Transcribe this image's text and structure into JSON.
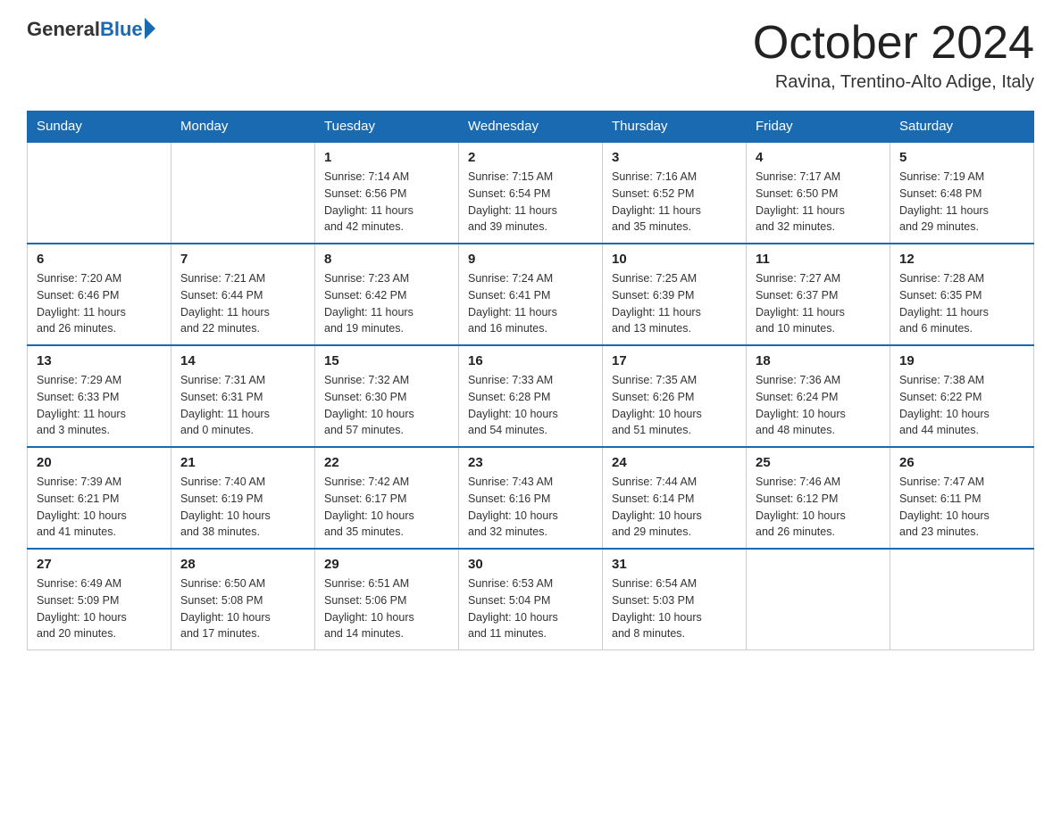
{
  "logo": {
    "general": "General",
    "blue": "Blue"
  },
  "title": "October 2024",
  "location": "Ravina, Trentino-Alto Adige, Italy",
  "headers": [
    "Sunday",
    "Monday",
    "Tuesday",
    "Wednesday",
    "Thursday",
    "Friday",
    "Saturday"
  ],
  "weeks": [
    [
      {
        "day": "",
        "details": ""
      },
      {
        "day": "",
        "details": ""
      },
      {
        "day": "1",
        "details": "Sunrise: 7:14 AM\nSunset: 6:56 PM\nDaylight: 11 hours\nand 42 minutes."
      },
      {
        "day": "2",
        "details": "Sunrise: 7:15 AM\nSunset: 6:54 PM\nDaylight: 11 hours\nand 39 minutes."
      },
      {
        "day": "3",
        "details": "Sunrise: 7:16 AM\nSunset: 6:52 PM\nDaylight: 11 hours\nand 35 minutes."
      },
      {
        "day": "4",
        "details": "Sunrise: 7:17 AM\nSunset: 6:50 PM\nDaylight: 11 hours\nand 32 minutes."
      },
      {
        "day": "5",
        "details": "Sunrise: 7:19 AM\nSunset: 6:48 PM\nDaylight: 11 hours\nand 29 minutes."
      }
    ],
    [
      {
        "day": "6",
        "details": "Sunrise: 7:20 AM\nSunset: 6:46 PM\nDaylight: 11 hours\nand 26 minutes."
      },
      {
        "day": "7",
        "details": "Sunrise: 7:21 AM\nSunset: 6:44 PM\nDaylight: 11 hours\nand 22 minutes."
      },
      {
        "day": "8",
        "details": "Sunrise: 7:23 AM\nSunset: 6:42 PM\nDaylight: 11 hours\nand 19 minutes."
      },
      {
        "day": "9",
        "details": "Sunrise: 7:24 AM\nSunset: 6:41 PM\nDaylight: 11 hours\nand 16 minutes."
      },
      {
        "day": "10",
        "details": "Sunrise: 7:25 AM\nSunset: 6:39 PM\nDaylight: 11 hours\nand 13 minutes."
      },
      {
        "day": "11",
        "details": "Sunrise: 7:27 AM\nSunset: 6:37 PM\nDaylight: 11 hours\nand 10 minutes."
      },
      {
        "day": "12",
        "details": "Sunrise: 7:28 AM\nSunset: 6:35 PM\nDaylight: 11 hours\nand 6 minutes."
      }
    ],
    [
      {
        "day": "13",
        "details": "Sunrise: 7:29 AM\nSunset: 6:33 PM\nDaylight: 11 hours\nand 3 minutes."
      },
      {
        "day": "14",
        "details": "Sunrise: 7:31 AM\nSunset: 6:31 PM\nDaylight: 11 hours\nand 0 minutes."
      },
      {
        "day": "15",
        "details": "Sunrise: 7:32 AM\nSunset: 6:30 PM\nDaylight: 10 hours\nand 57 minutes."
      },
      {
        "day": "16",
        "details": "Sunrise: 7:33 AM\nSunset: 6:28 PM\nDaylight: 10 hours\nand 54 minutes."
      },
      {
        "day": "17",
        "details": "Sunrise: 7:35 AM\nSunset: 6:26 PM\nDaylight: 10 hours\nand 51 minutes."
      },
      {
        "day": "18",
        "details": "Sunrise: 7:36 AM\nSunset: 6:24 PM\nDaylight: 10 hours\nand 48 minutes."
      },
      {
        "day": "19",
        "details": "Sunrise: 7:38 AM\nSunset: 6:22 PM\nDaylight: 10 hours\nand 44 minutes."
      }
    ],
    [
      {
        "day": "20",
        "details": "Sunrise: 7:39 AM\nSunset: 6:21 PM\nDaylight: 10 hours\nand 41 minutes."
      },
      {
        "day": "21",
        "details": "Sunrise: 7:40 AM\nSunset: 6:19 PM\nDaylight: 10 hours\nand 38 minutes."
      },
      {
        "day": "22",
        "details": "Sunrise: 7:42 AM\nSunset: 6:17 PM\nDaylight: 10 hours\nand 35 minutes."
      },
      {
        "day": "23",
        "details": "Sunrise: 7:43 AM\nSunset: 6:16 PM\nDaylight: 10 hours\nand 32 minutes."
      },
      {
        "day": "24",
        "details": "Sunrise: 7:44 AM\nSunset: 6:14 PM\nDaylight: 10 hours\nand 29 minutes."
      },
      {
        "day": "25",
        "details": "Sunrise: 7:46 AM\nSunset: 6:12 PM\nDaylight: 10 hours\nand 26 minutes."
      },
      {
        "day": "26",
        "details": "Sunrise: 7:47 AM\nSunset: 6:11 PM\nDaylight: 10 hours\nand 23 minutes."
      }
    ],
    [
      {
        "day": "27",
        "details": "Sunrise: 6:49 AM\nSunset: 5:09 PM\nDaylight: 10 hours\nand 20 minutes."
      },
      {
        "day": "28",
        "details": "Sunrise: 6:50 AM\nSunset: 5:08 PM\nDaylight: 10 hours\nand 17 minutes."
      },
      {
        "day": "29",
        "details": "Sunrise: 6:51 AM\nSunset: 5:06 PM\nDaylight: 10 hours\nand 14 minutes."
      },
      {
        "day": "30",
        "details": "Sunrise: 6:53 AM\nSunset: 5:04 PM\nDaylight: 10 hours\nand 11 minutes."
      },
      {
        "day": "31",
        "details": "Sunrise: 6:54 AM\nSunset: 5:03 PM\nDaylight: 10 hours\nand 8 minutes."
      },
      {
        "day": "",
        "details": ""
      },
      {
        "day": "",
        "details": ""
      }
    ]
  ]
}
